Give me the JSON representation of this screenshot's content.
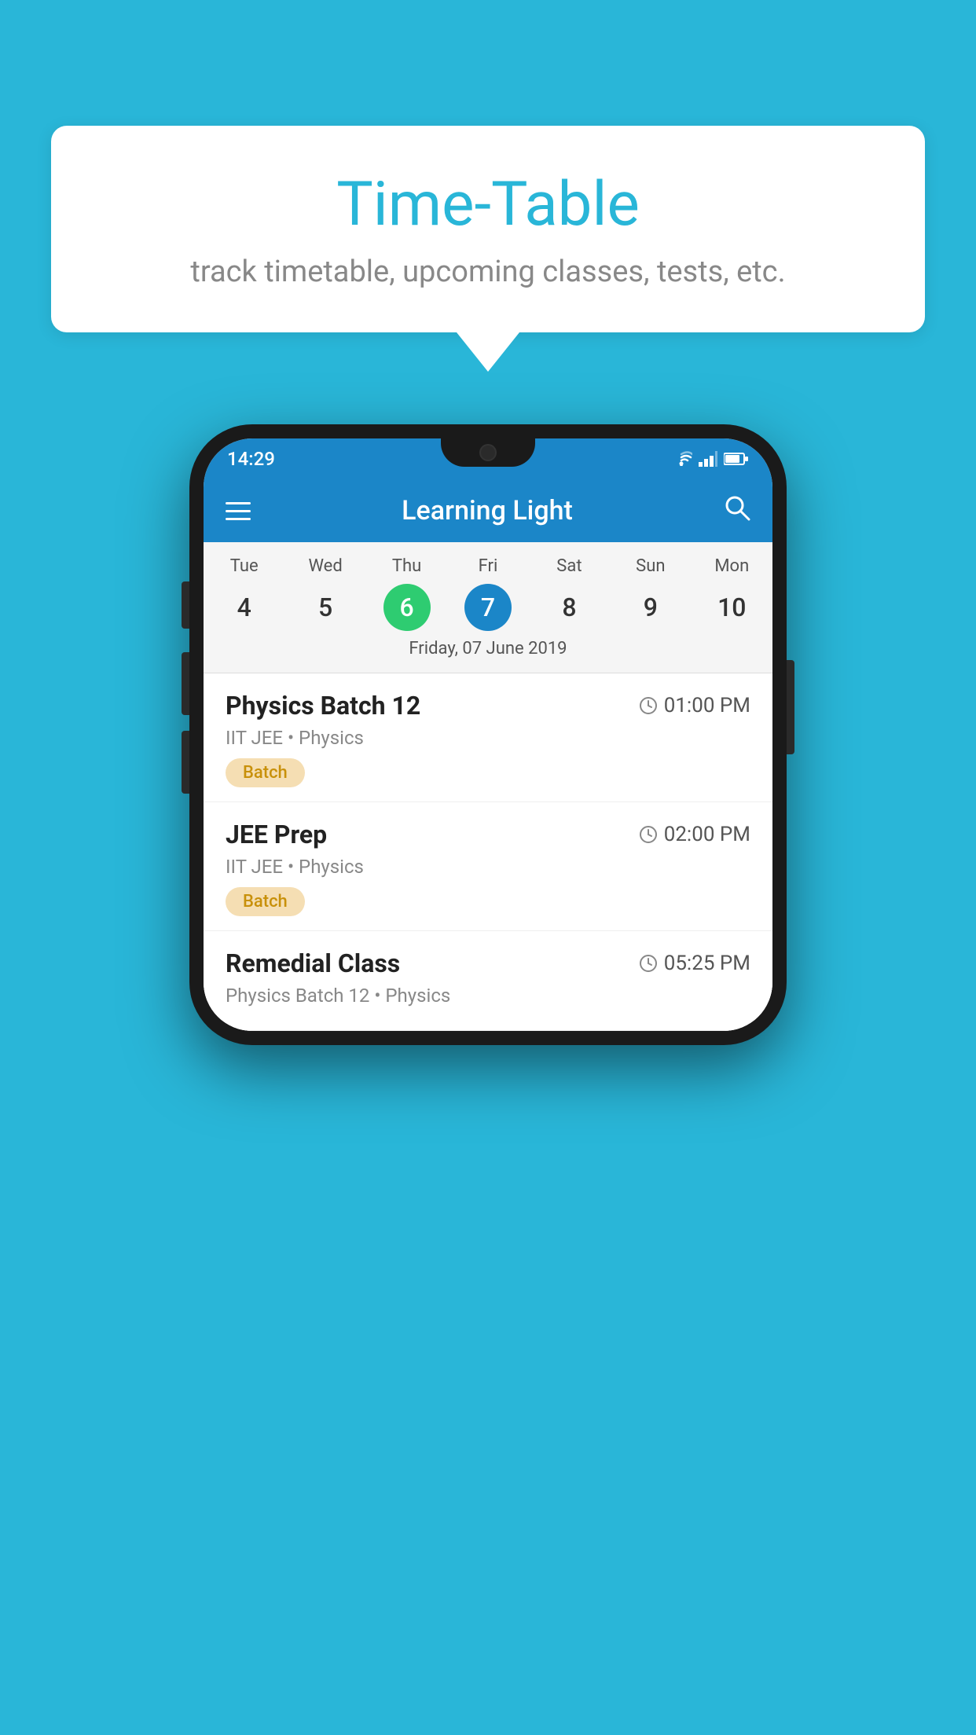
{
  "background_color": "#29b6d8",
  "speech_bubble": {
    "title": "Time-Table",
    "subtitle": "track timetable, upcoming classes, tests, etc."
  },
  "phone": {
    "status_bar": {
      "time": "14:29"
    },
    "app_bar": {
      "title": "Learning Light"
    },
    "calendar": {
      "days": [
        {
          "name": "Tue",
          "num": "4",
          "state": "normal"
        },
        {
          "name": "Wed",
          "num": "5",
          "state": "normal"
        },
        {
          "name": "Thu",
          "num": "6",
          "state": "today"
        },
        {
          "name": "Fri",
          "num": "7",
          "state": "selected"
        },
        {
          "name": "Sat",
          "num": "8",
          "state": "normal"
        },
        {
          "name": "Sun",
          "num": "9",
          "state": "normal"
        },
        {
          "name": "Mon",
          "num": "10",
          "state": "normal"
        }
      ],
      "selected_date_label": "Friday, 07 June 2019"
    },
    "schedule": [
      {
        "title": "Physics Batch 12",
        "time": "01:00 PM",
        "subtitle": "IIT JEE • Physics",
        "badge": "Batch"
      },
      {
        "title": "JEE Prep",
        "time": "02:00 PM",
        "subtitle": "IIT JEE • Physics",
        "badge": "Batch"
      },
      {
        "title": "Remedial Class",
        "time": "05:25 PM",
        "subtitle": "Physics Batch 12 • Physics",
        "badge": ""
      }
    ]
  }
}
